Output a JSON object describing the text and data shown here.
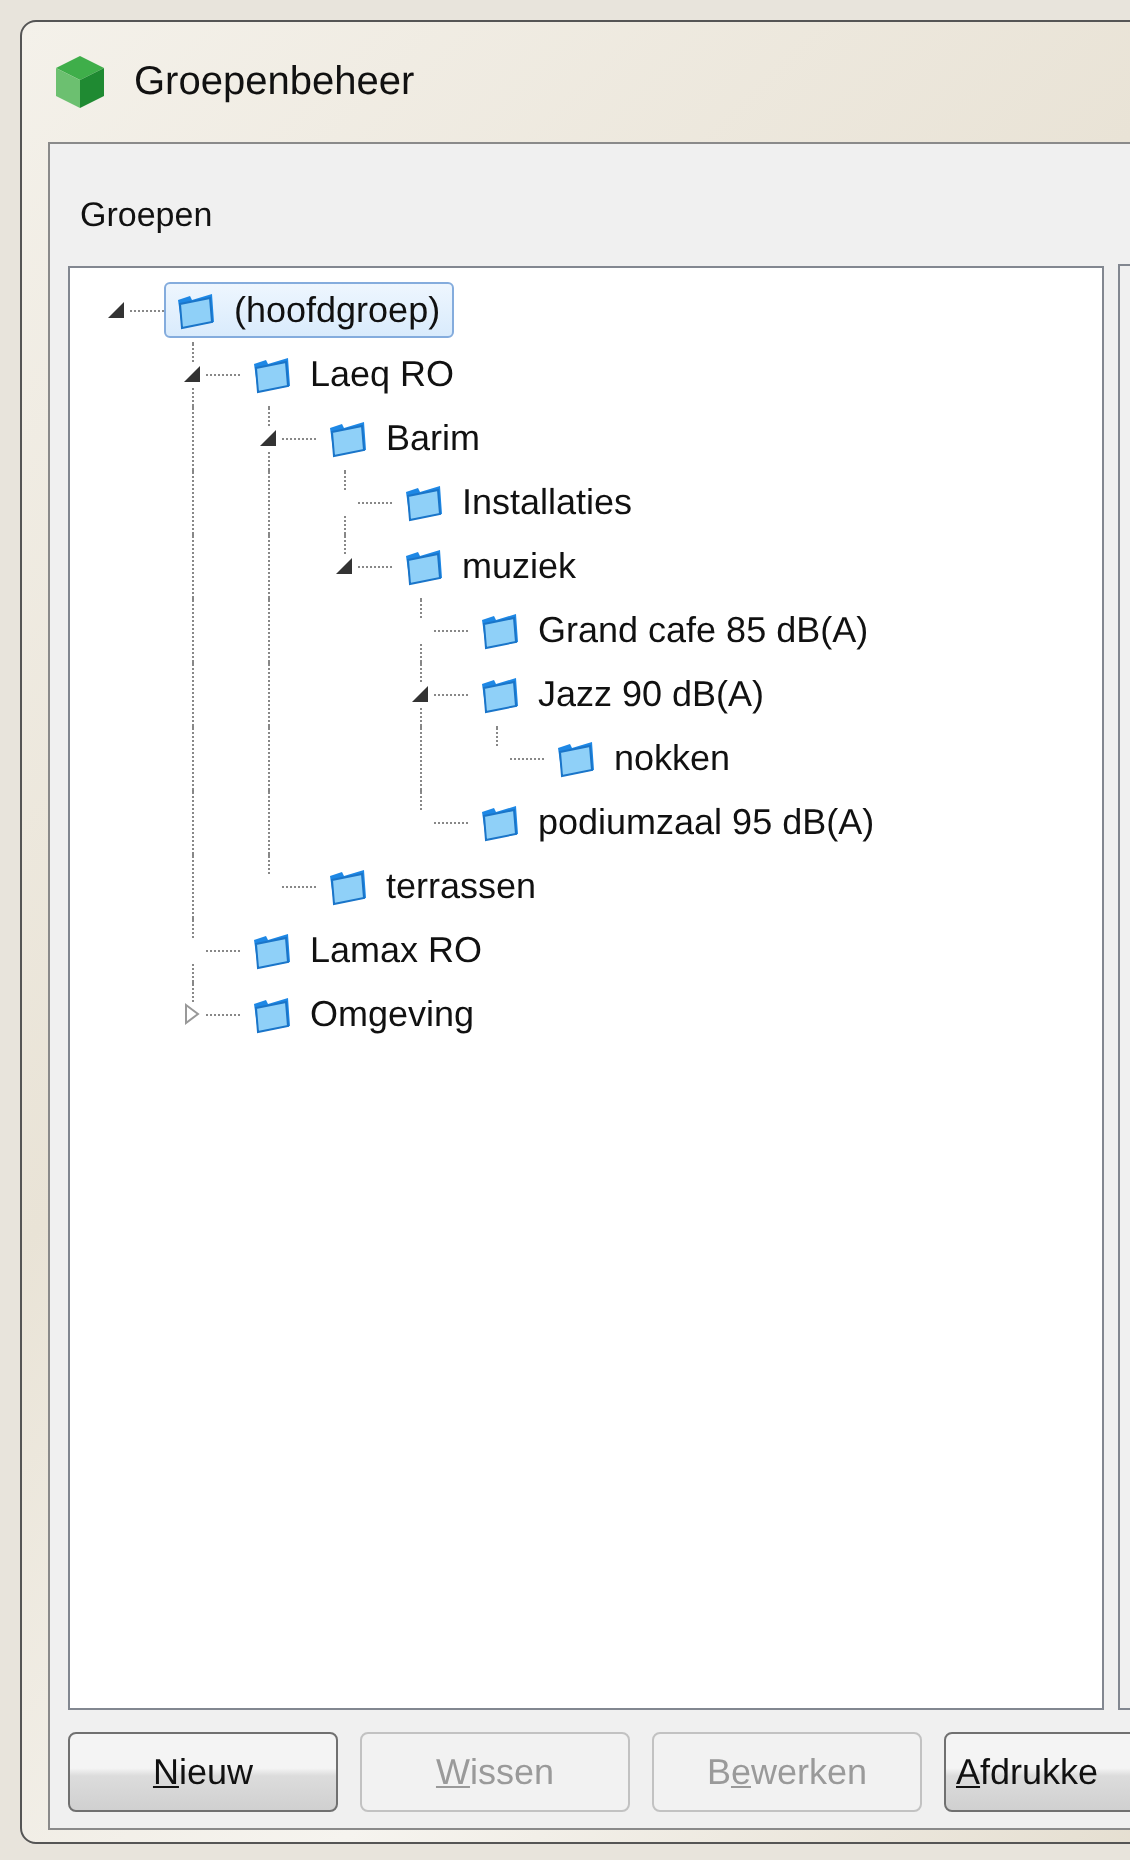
{
  "window": {
    "title": "Groepenbeheer"
  },
  "groups_panel": {
    "label": "Groepen",
    "tree": [
      {
        "label": "(hoofdgroep)",
        "selected": true,
        "expanded": true,
        "children": [
          {
            "label": "Laeq RO",
            "selected": false,
            "expanded": true,
            "children": [
              {
                "label": "Barim",
                "selected": false,
                "expanded": true,
                "children": [
                  {
                    "label": "Installaties",
                    "selected": false
                  },
                  {
                    "label": "muziek",
                    "selected": false,
                    "expanded": true,
                    "children": [
                      {
                        "label": "Grand cafe 85 dB(A)",
                        "selected": false
                      },
                      {
                        "label": "Jazz 90 dB(A)",
                        "selected": false,
                        "expanded": true,
                        "children": [
                          {
                            "label": "nokken",
                            "selected": false
                          }
                        ]
                      },
                      {
                        "label": "podiumzaal 95 dB(A)",
                        "selected": false
                      }
                    ]
                  }
                ]
              },
              {
                "label": "terrassen",
                "selected": false
              }
            ]
          },
          {
            "label": "Lamax RO",
            "selected": false
          },
          {
            "label": "Omgeving",
            "selected": false,
            "expanded": false
          }
        ]
      }
    ]
  },
  "buttons": [
    {
      "key": "N",
      "after": "ieuw",
      "disabled": false
    },
    {
      "key": "W",
      "after": "issen",
      "disabled": true
    },
    {
      "before": "B",
      "key": "e",
      "after": "werken",
      "disabled": true
    },
    {
      "key": "A",
      "after": "fdrukke",
      "disabled": false
    }
  ]
}
